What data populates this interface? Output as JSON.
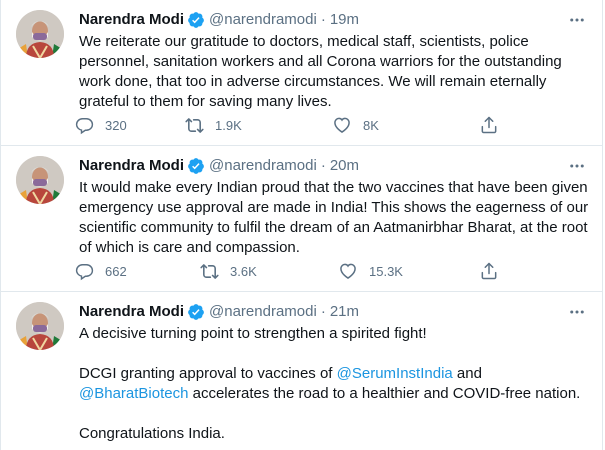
{
  "colors": {
    "text": "#0f1419",
    "secondary": "#5b7083",
    "link": "#1b95e0",
    "verified": "#1da1f2",
    "divider": "#e1e8ed"
  },
  "tweets": [
    {
      "author": {
        "name": "Narendra Modi",
        "handle": "@narendramodi",
        "verified_icon": "verified-badge-icon"
      },
      "separator": "·",
      "time": "19m",
      "text": "We reiterate our gratitude to doctors, medical staff, scientists, police personnel, sanitation workers and all Corona warriors for the outstanding work done, that too in adverse circumstances. We will remain eternally grateful to them for saving many lives.",
      "replies": "320",
      "retweets": "1.9K",
      "likes": "8K"
    },
    {
      "author": {
        "name": "Narendra Modi",
        "handle": "@narendramodi",
        "verified_icon": "verified-badge-icon"
      },
      "separator": "·",
      "time": "20m",
      "text": "It would make every Indian proud that the two vaccines that have been given emergency use approval are made in India! This shows the eagerness of our scientific community to fulfil the dream of an Aatmanirbhar Bharat, at the root of which is care and compassion.",
      "replies": "662",
      "retweets": "3.6K",
      "likes": "15.3K"
    },
    {
      "author": {
        "name": "Narendra Modi",
        "handle": "@narendramodi",
        "verified_icon": "verified-badge-icon"
      },
      "separator": "·",
      "time": "21m",
      "line1": "A decisive turning point to strengthen a spirited fight!",
      "line2_pre": "DCGI granting approval to vaccines of ",
      "mention1": "@SerumInstIndia",
      "line2_mid": " and ",
      "mention2": "@BharatBiotech",
      "line2_post": " accelerates the road to a healthier and COVID-free nation.",
      "line3": "Congratulations India."
    }
  ]
}
